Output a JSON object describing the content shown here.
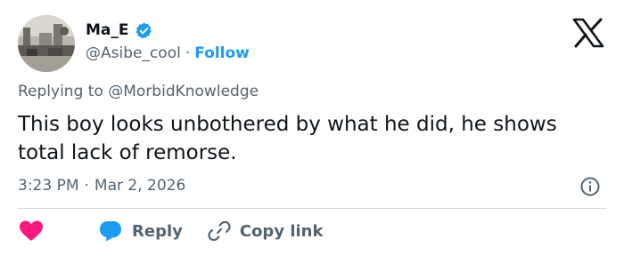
{
  "user": {
    "display_name": "Ma_E",
    "handle": "@Asibe_cool",
    "separator": "·",
    "follow_label": "Follow",
    "verified_color": "#1d9bf0"
  },
  "reply_context": {
    "prefix": "Replying to",
    "mention": "@MorbidKnowledge"
  },
  "tweet": {
    "text": "This boy looks unbothered by what he did, he shows total lack of remorse.",
    "time": "3:23 PM",
    "separator": "·",
    "date": "Mar 2, 2026"
  },
  "actions": {
    "like_icon": "heart-icon",
    "like_color": "#f91880",
    "reply_label": "Reply",
    "reply_icon": "speech-bubble-icon",
    "reply_color": "#1d9bf0",
    "copy_label": "Copy link",
    "copy_icon": "link-icon"
  },
  "colors": {
    "text": "#0f1419",
    "secondary": "#536471",
    "accent": "#1d9bf0",
    "divider": "#cfd9de"
  }
}
